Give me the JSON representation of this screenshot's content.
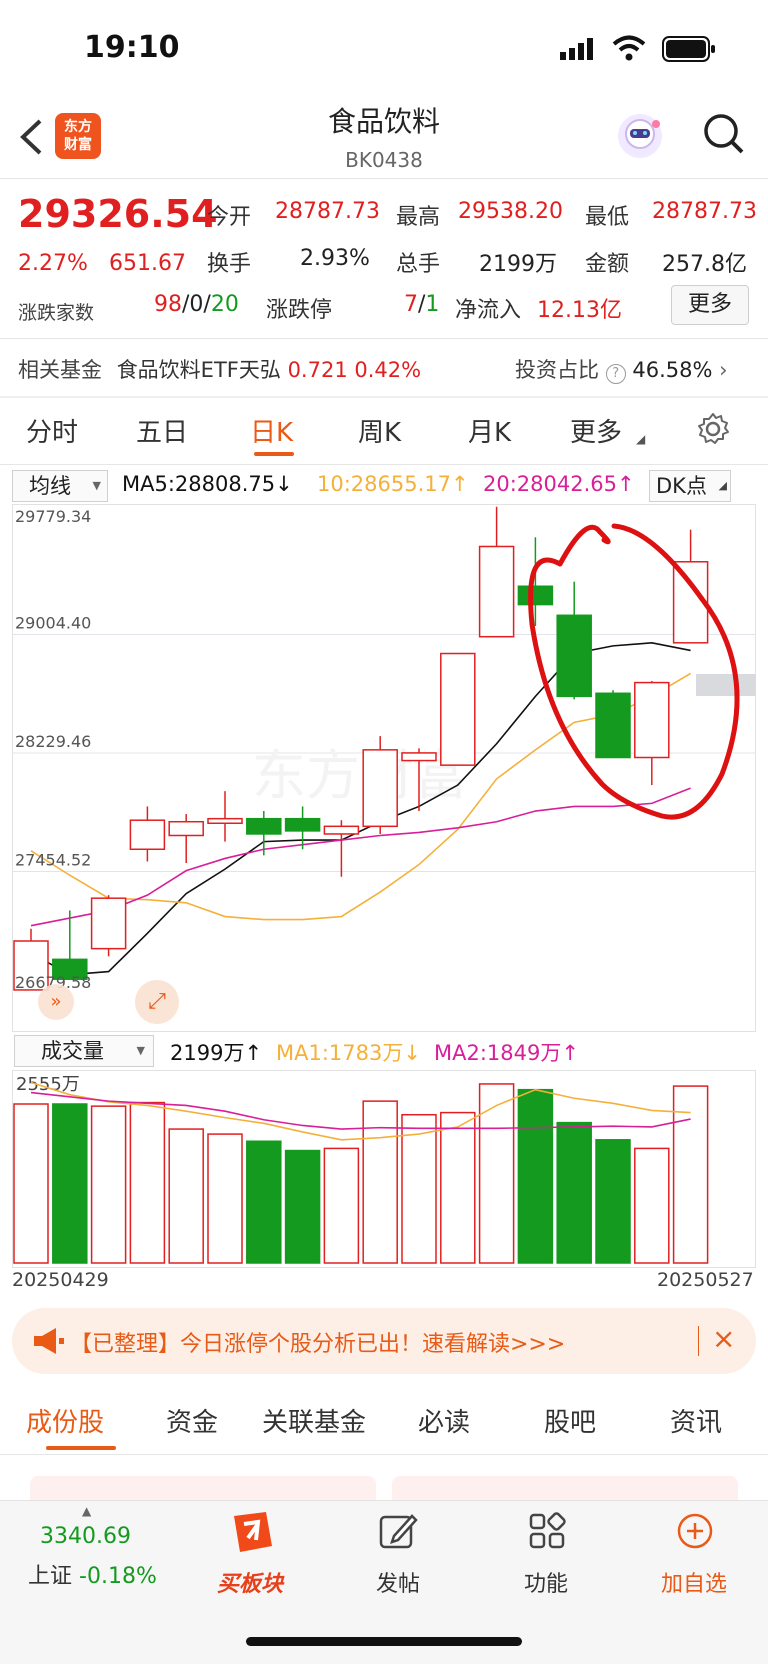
{
  "status_bar": {
    "time": "19:10"
  },
  "header": {
    "title": "食品饮料",
    "code": "BK0438",
    "logo_text_1": "东方",
    "logo_text_2": "财富"
  },
  "quote": {
    "price": "29326.54",
    "change_pct": "2.27%",
    "change_amt": "651.67",
    "open_label": "今开",
    "open": "28787.73",
    "high_label": "最高",
    "high": "29538.20",
    "low_label": "最低",
    "low": "28787.73",
    "turnover_label": "换手",
    "turnover": "2.93%",
    "volume_label": "总手",
    "volume": "2199万",
    "amount_label": "金额",
    "amount": "257.8亿",
    "updown_label": "涨跌家数",
    "up_count": "98",
    "flat_count": "0",
    "down_count": "20",
    "limit_label": "涨跌停",
    "limit_up": "7",
    "limit_down": "1",
    "inflow_label": "净流入",
    "inflow": "12.13亿",
    "more_button": "更多"
  },
  "fund": {
    "label": "相关基金",
    "name": "食品饮料ETF天弘",
    "price": "0.721",
    "pct": "0.42%",
    "ratio_label": "投资占比",
    "ratio": "46.58%"
  },
  "chart_tabs": [
    "分时",
    "五日",
    "日K",
    "周K",
    "月K",
    "更多"
  ],
  "active_tab": "日K",
  "ma_bar": {
    "selector": "均线",
    "ma5": "MA5:28808.75",
    "ma10": "10:28655.17",
    "ma20": "20:28042.65",
    "dk": "DK点"
  },
  "volume_bar": {
    "selector": "成交量",
    "vol": "2199万",
    "ma1": "MA1:1783万",
    "ma2": "MA2:1849万"
  },
  "colors": {
    "up": "#e02020",
    "down": "#139a1f",
    "ma5": "#111111",
    "ma10": "#f5b03a",
    "ma20": "#d81f9a",
    "annotation": "#dd1111"
  },
  "chart_data": {
    "type": "candlestick",
    "y_ticks": [
      "29779.34",
      "29004.40",
      "28229.46",
      "27454.52",
      "26679.58"
    ],
    "ylim": [
      26679.58,
      29779.34
    ],
    "x_start": "20250429",
    "x_end": "20250527",
    "volume_max_label": "2555万",
    "candles": [
      {
        "o": 26680,
        "c": 27000,
        "h": 27080,
        "l": 26680
      },
      {
        "o": 26880,
        "c": 26750,
        "h": 27200,
        "l": 26750
      },
      {
        "o": 26950,
        "c": 27280,
        "h": 27300,
        "l": 26900
      },
      {
        "o": 27600,
        "c": 27790,
        "h": 27880,
        "l": 27520
      },
      {
        "o": 27690,
        "c": 27780,
        "h": 27830,
        "l": 27510
      },
      {
        "o": 27770,
        "c": 27800,
        "h": 27980,
        "l": 27650
      },
      {
        "o": 27800,
        "c": 27700,
        "h": 27850,
        "l": 27560
      },
      {
        "o": 27800,
        "c": 27720,
        "h": 27880,
        "l": 27600
      },
      {
        "o": 27700,
        "c": 27750,
        "h": 27790,
        "l": 27420
      },
      {
        "o": 27750,
        "c": 28250,
        "h": 28340,
        "l": 27700
      },
      {
        "o": 28180,
        "c": 28230,
        "h": 28260,
        "l": 27850
      },
      {
        "o": 28150,
        "c": 28880,
        "h": 28880,
        "l": 28150
      },
      {
        "o": 28990,
        "c": 29580,
        "h": 29840,
        "l": 28990
      },
      {
        "o": 29320,
        "c": 29200,
        "h": 29640,
        "l": 29060
      },
      {
        "o": 29130,
        "c": 28600,
        "h": 29350,
        "l": 28580
      },
      {
        "o": 28620,
        "c": 28200,
        "h": 28640,
        "l": 28200
      },
      {
        "o": 28200,
        "c": 28690,
        "h": 28700,
        "l": 28020
      },
      {
        "o": 28950,
        "c": 29480,
        "h": 29690,
        "l": 28950
      }
    ],
    "ma5": [
      26920,
      26780,
      26800,
      27050,
      27310,
      27470,
      27650,
      27660,
      27660,
      27780,
      27880,
      28020,
      28290,
      28600,
      28880,
      28930,
      28950,
      28900
    ],
    "ma10": [
      27590,
      27430,
      27280,
      27270,
      27250,
      27160,
      27140,
      27140,
      27160,
      27320,
      27500,
      27730,
      28060,
      28250,
      28430,
      28480,
      28600,
      28750
    ],
    "ma20": [
      27100,
      27150,
      27200,
      27300,
      27460,
      27540,
      27600,
      27630,
      27660,
      27690,
      27710,
      27740,
      27780,
      27850,
      27880,
      27880,
      27900,
      28000
    ],
    "volumes": [
      2220,
      2220,
      2190,
      2240,
      1870,
      1800,
      1700,
      1570,
      1600,
      2260,
      2070,
      2100,
      2500,
      2420,
      1960,
      1720,
      1600,
      2470
    ],
    "vol_ma1": [
      2520,
      2350,
      2250,
      2200,
      2120,
      2030,
      1950,
      1830,
      1720,
      1750,
      1800,
      1900,
      2200,
      2420,
      2300,
      2230,
      2130,
      2100
    ],
    "vol_ma2": [
      2380,
      2320,
      2260,
      2230,
      2200,
      2120,
      2000,
      1920,
      1870,
      1890,
      1880,
      1880,
      1880,
      1890,
      1900,
      1910,
      1900,
      2010
    ]
  },
  "banner": {
    "text": "【已整理】今日涨停个股分析已出！速看解读>>>"
  },
  "sub_tabs": [
    "成份股",
    "资金",
    "关联基金",
    "必读",
    "股吧",
    "资讯"
  ],
  "bottom_nav": {
    "index_value": "3340.69",
    "index_name": "上证",
    "index_pct": "-0.18%",
    "items": [
      "买板块",
      "发帖",
      "功能",
      "加自选"
    ]
  }
}
